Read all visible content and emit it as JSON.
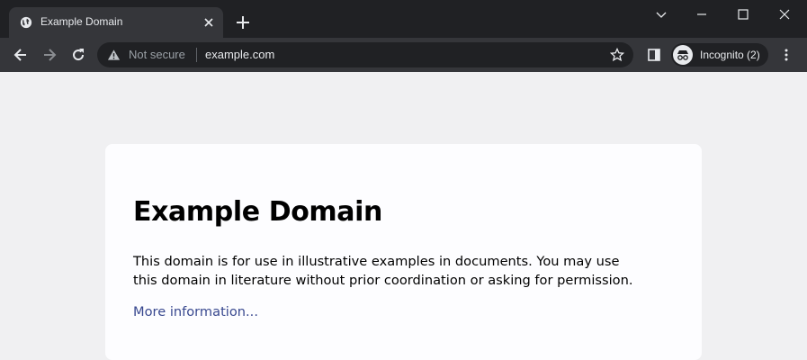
{
  "tab": {
    "title": "Example Domain"
  },
  "omnibox": {
    "security_label": "Not secure",
    "url": "example.com"
  },
  "profile": {
    "label": "Incognito (2)"
  },
  "page": {
    "heading": "Example Domain",
    "paragraph": "This domain is for use in illustrative examples in documents. You may use this domain in literature without prior coordination or asking for permission.",
    "link_text": "More information..."
  },
  "colors": {
    "titlebar": "#202124",
    "toolbar": "#35363a",
    "page_background": "#f0f0f2",
    "card_background": "#fdfdff",
    "link": "#38488f"
  }
}
